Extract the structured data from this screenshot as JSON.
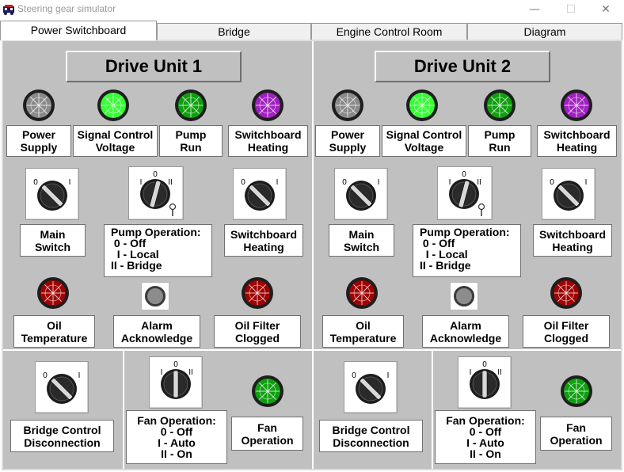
{
  "window": {
    "title": "Steering gear simulator",
    "minimize_glyph": "—",
    "maximize_glyph": "☐",
    "close_glyph": "✕"
  },
  "tabs": [
    {
      "label": "Power Switchboard",
      "active": true
    },
    {
      "label": "Bridge",
      "active": false
    },
    {
      "label": "Engine Control Room",
      "active": false
    },
    {
      "label": "Diagram",
      "active": false
    }
  ],
  "colors": {
    "lamp_grey": "#8a8a8a",
    "lamp_bright_green": "#33ff33",
    "lamp_green": "#0e9f0e",
    "lamp_purple": "#a020c0",
    "lamp_red": "#a00000",
    "panel_bg": "#c0c0c0"
  },
  "units": [
    {
      "title": "Drive Unit 1",
      "lamps": [
        {
          "line1": "Power",
          "line2": "Supply",
          "color": "#8a8a8a",
          "icon": "lamp-power-supply"
        },
        {
          "line1": "Signal Control",
          "line2": "Voltage",
          "color": "#33ff33",
          "icon": "lamp-signal-control"
        },
        {
          "line1": "Pump",
          "line2": "Run",
          "color": "#0e9f0e",
          "icon": "lamp-pump-run"
        },
        {
          "line1": "Switchboard",
          "line2": "Heating",
          "color": "#a020c0",
          "icon": "lamp-switchboard-heating"
        }
      ],
      "switches": {
        "main": {
          "line1": "Main",
          "line2": "Switch",
          "pos0": "0",
          "pos1": "I"
        },
        "pump": {
          "line1": "Pump Operation:",
          "line2": " 0 - Off",
          "line3": "  I - Local",
          "line4": "II - Bridge",
          "pos0": "0",
          "pos1": "I",
          "pos2": "II"
        },
        "heating": {
          "line1": "Switchboard",
          "line2": "Heating",
          "pos0": "0",
          "pos1": "I"
        }
      },
      "alarms": {
        "oil_temp": {
          "line1": "Oil",
          "line2": "Temperature"
        },
        "ack": {
          "line1": "Alarm",
          "line2": "Acknowledge"
        },
        "filter": {
          "line1": "Oil Filter",
          "line2": "Clogged"
        }
      },
      "bottom": {
        "bridge": {
          "line1": "Bridge Control",
          "line2": "Disconnection",
          "pos0": "0",
          "pos1": "I"
        },
        "fan_op": {
          "line1": "Fan Operation:",
          "line2": "0 - Off",
          "line3": "I - Auto",
          "line4": "II - On",
          "pos0": "0",
          "pos1": "I",
          "pos2": "II"
        },
        "fan_lamp": {
          "line1": "Fan",
          "line2": "Operation"
        }
      }
    },
    {
      "title": "Drive Unit 2",
      "lamps": [
        {
          "line1": "Power",
          "line2": "Supply",
          "color": "#8a8a8a",
          "icon": "lamp-power-supply"
        },
        {
          "line1": "Signal Control",
          "line2": "Voltage",
          "color": "#33ff33",
          "icon": "lamp-signal-control"
        },
        {
          "line1": "Pump",
          "line2": "Run",
          "color": "#0e9f0e",
          "icon": "lamp-pump-run"
        },
        {
          "line1": "Switchboard",
          "line2": "Heating",
          "color": "#a020c0",
          "icon": "lamp-switchboard-heating"
        }
      ],
      "switches": {
        "main": {
          "line1": "Main",
          "line2": "Switch",
          "pos0": "0",
          "pos1": "I"
        },
        "pump": {
          "line1": "Pump Operation:",
          "line2": " 0 - Off",
          "line3": "  I - Local",
          "line4": "II - Bridge",
          "pos0": "0",
          "pos1": "I",
          "pos2": "II"
        },
        "heating": {
          "line1": "Switchboard",
          "line2": "Heating",
          "pos0": "0",
          "pos1": "I"
        }
      },
      "alarms": {
        "oil_temp": {
          "line1": "Oil",
          "line2": "Temperature"
        },
        "ack": {
          "line1": "Alarm",
          "line2": "Acknowledge"
        },
        "filter": {
          "line1": "Oil Filter",
          "line2": "Clogged"
        }
      },
      "bottom": {
        "bridge": {
          "line1": "Bridge Control",
          "line2": "Disconnection",
          "pos0": "0",
          "pos1": "I"
        },
        "fan_op": {
          "line1": "Fan Operation:",
          "line2": "0 - Off",
          "line3": "I - Auto",
          "line4": "II - On",
          "pos0": "0",
          "pos1": "I",
          "pos2": "II"
        },
        "fan_lamp": {
          "line1": "Fan",
          "line2": "Operation"
        }
      }
    }
  ]
}
